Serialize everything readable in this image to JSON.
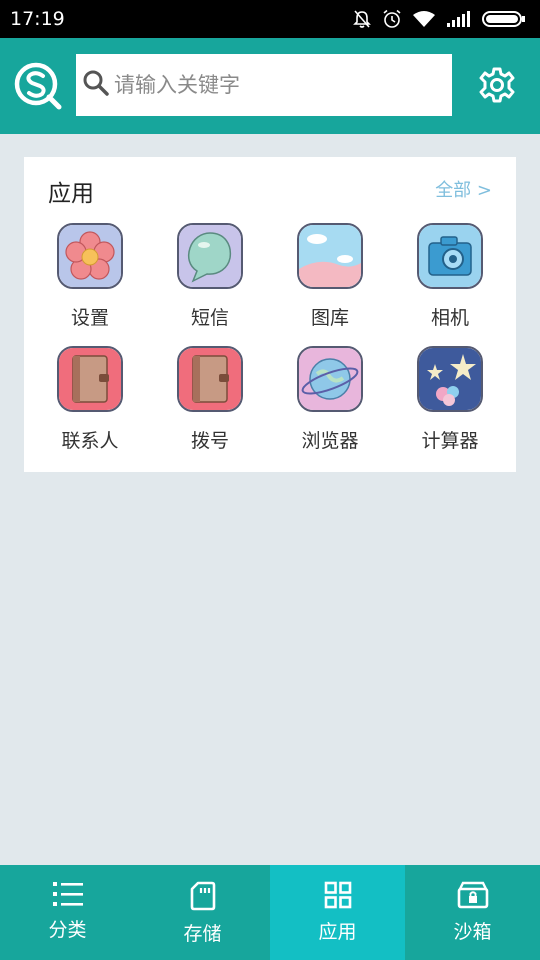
{
  "status_bar": {
    "time": "17:19",
    "icons": [
      "mute-bell-icon",
      "alarm-icon",
      "wifi-icon",
      "signal-icon",
      "battery-icon"
    ]
  },
  "header": {
    "logo_icon": "search-logo-icon",
    "search_placeholder": "请输入关键字",
    "settings_icon": "gear-icon"
  },
  "apps_section": {
    "title": "应用",
    "more_label": "全部 >",
    "apps": [
      {
        "label": "设置",
        "icon": "flower-icon"
      },
      {
        "label": "短信",
        "icon": "speech-bubble-icon"
      },
      {
        "label": "图库",
        "icon": "landscape-icon"
      },
      {
        "label": "相机",
        "icon": "camera-icon"
      },
      {
        "label": "联系人",
        "icon": "notebook-icon"
      },
      {
        "label": "拨号",
        "icon": "notebook-icon"
      },
      {
        "label": "浏览器",
        "icon": "planet-icon"
      },
      {
        "label": "计算器",
        "icon": "stars-icon"
      }
    ]
  },
  "bottom_nav": {
    "items": [
      {
        "label": "分类",
        "icon": "list-icon"
      },
      {
        "label": "存储",
        "icon": "sd-card-icon"
      },
      {
        "label": "应用",
        "icon": "grid-icon"
      },
      {
        "label": "沙箱",
        "icon": "lockbox-icon"
      }
    ],
    "active_index": 2
  },
  "colors": {
    "primary": "#17a69c",
    "active_tab": "#13bfc4",
    "background": "#e1e8ec",
    "link": "#7fbedd"
  }
}
